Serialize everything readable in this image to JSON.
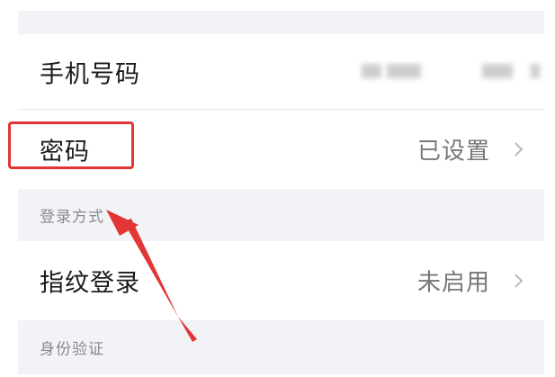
{
  "rows": {
    "phone": {
      "label": "手机号码"
    },
    "password": {
      "label": "密码",
      "value": "已设置"
    },
    "fingerprint": {
      "label": "指纹登录",
      "value": "未启用"
    }
  },
  "sections": {
    "login_methods": "登录方式",
    "identity_verification": "身份验证"
  },
  "colors": {
    "annotation_red": "#e23535",
    "section_background": "#f2f3f6"
  },
  "icons": {
    "row_chevron": "chevron-right-icon",
    "annotation_arrow": "annotation-arrow-icon"
  }
}
